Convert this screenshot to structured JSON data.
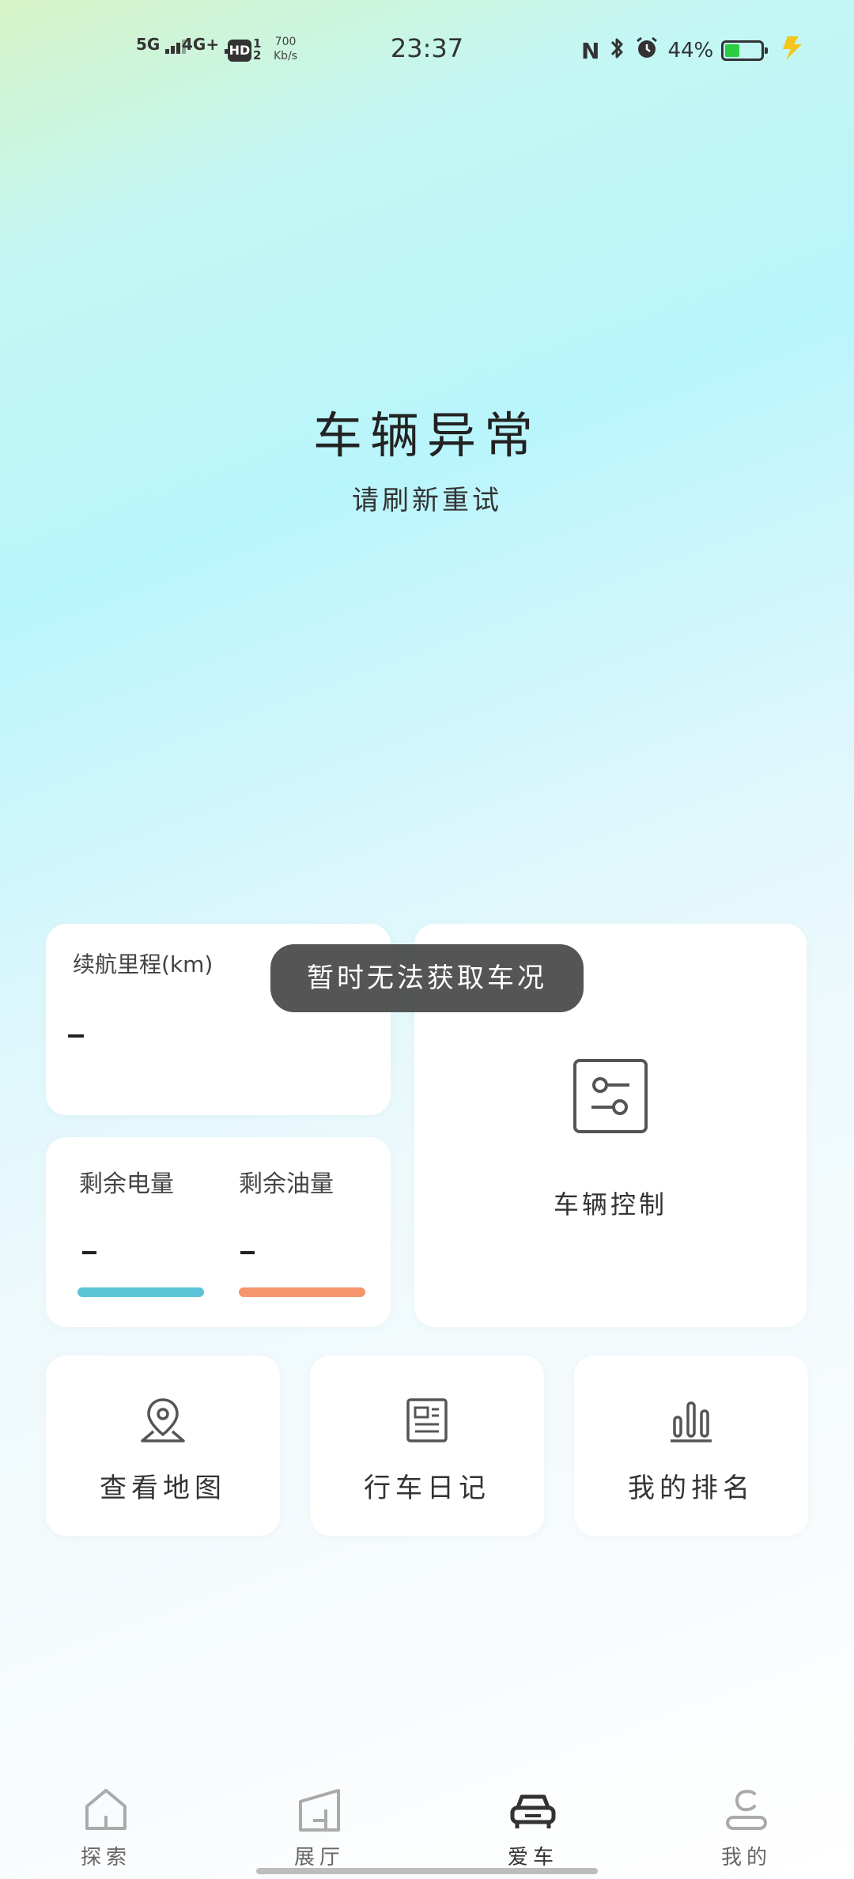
{
  "status_bar": {
    "network1": "5G",
    "network2": "4G+",
    "hd_badge": "HD",
    "sim_sub": "1 2",
    "speed_value": "700",
    "speed_unit": "Kb/s",
    "time": "23:37",
    "nfc": "N",
    "battery_percent": "44%",
    "battery_level": 0.44,
    "charging": true
  },
  "hero": {
    "title": "车辆异常",
    "subtitle": "请刷新重试"
  },
  "range_card": {
    "label": "续航里程(km)",
    "value": "-"
  },
  "energy_card": {
    "battery_label": "剩余电量",
    "battery_value": "-",
    "fuel_label": "剩余油量",
    "fuel_value": "-",
    "battery_bar_color": "#5bc3d6",
    "fuel_bar_color": "#f4956c"
  },
  "control_card": {
    "label": "车辆控制",
    "icon": "sliders-icon"
  },
  "tiles": [
    {
      "label": "查看地图",
      "icon": "map-pin-icon"
    },
    {
      "label": "行车日记",
      "icon": "newspaper-icon"
    },
    {
      "label": "我的排名",
      "icon": "bar-chart-icon"
    }
  ],
  "toast": {
    "message": "暂时无法获取车况"
  },
  "bottom_nav": {
    "items": [
      {
        "label": "探索",
        "icon": "home-icon",
        "active": false
      },
      {
        "label": "展厅",
        "icon": "building-icon",
        "active": false
      },
      {
        "label": "爱车",
        "icon": "car-icon",
        "active": true
      },
      {
        "label": "我的",
        "icon": "person-icon",
        "active": false
      }
    ]
  }
}
